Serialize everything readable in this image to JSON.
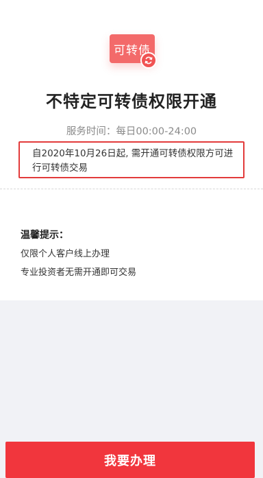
{
  "header": {
    "logo_text": "可转债",
    "refresh_icon": "refresh-icon",
    "title": "不特定可转债权限开通",
    "service_hours": "服务时间：每日00:00-24:00"
  },
  "notice": {
    "text": "自2020年10月26日起, 需开通可转债权限方可进行可转债交易"
  },
  "tips": {
    "title": "温馨提示：",
    "items": [
      "仅限个人客户线上办理",
      "专业投资者无需开通即可交易"
    ]
  },
  "action": {
    "button_label": "我要办理"
  },
  "colors": {
    "brand_red": "#f1363d",
    "highlight_border": "#e23a3a",
    "muted_text": "#8a8a8a",
    "bottom_background": "#f1f2f6"
  }
}
